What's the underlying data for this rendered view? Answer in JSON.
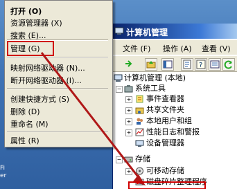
{
  "context_menu": {
    "items": [
      {
        "label": "打开 (O)",
        "bold": true
      },
      {
        "label": "资源管理器 (X)"
      },
      {
        "label": "搜索 (E)..."
      },
      {
        "label": "管理 (G)",
        "highlighted": true
      },
      {
        "label": "映射网络驱动器 (N)..."
      },
      {
        "label": "断开网络驱动器 (I)..."
      },
      {
        "label": "创建快捷方式 (S)"
      },
      {
        "label": "删除 (D)"
      },
      {
        "label": "重命名 (M)"
      },
      {
        "label": "属性 (R)"
      }
    ]
  },
  "window": {
    "title": "计算机管理",
    "menu": [
      "文件 (F)",
      "操作 (A)",
      "查看 (V)"
    ],
    "tree": {
      "root": "计算机管理 (本地)",
      "system_tools": "系统工具",
      "event_viewer": "事件查看器",
      "shared_folders": "共享文件夹",
      "local_users": "本地用户和组",
      "perf_logs": "性能日志和警报",
      "device_manager": "设备管理器",
      "storage": "存储",
      "removable": "可移动存储",
      "defrag": "磁盘碎片整理程序"
    }
  },
  "desktop": {
    "partial_text_1": "Fi",
    "partial_text_2": "er"
  },
  "colors": {
    "highlight_box": "#d00000",
    "arrow": "#b01818",
    "title_bar": "#0a246a"
  }
}
